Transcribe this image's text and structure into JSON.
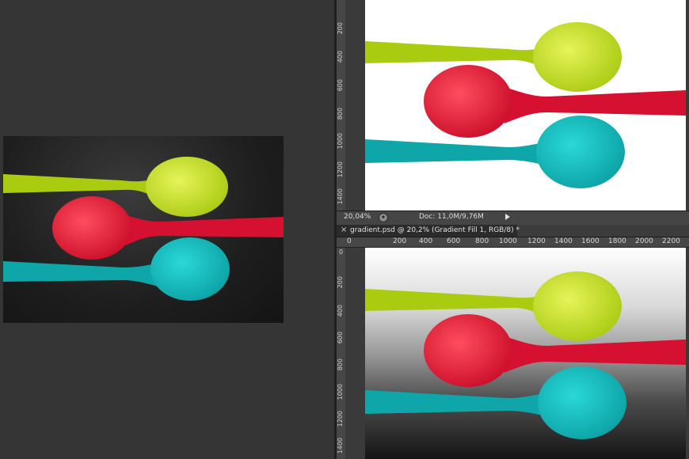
{
  "left_preview": {
    "image_description_icon": "spoons-photo-dark"
  },
  "document1": {
    "vertical_ruler_labels": [
      "200",
      "400",
      "600",
      "800",
      "1000",
      "1200",
      "1400"
    ]
  },
  "status_bar": {
    "zoom": "20,04%",
    "doc_size": "Doc: 11,0M/9,76M"
  },
  "document2": {
    "tab_close": "×",
    "tab_title": "gradient.psd @ 20,2% (Gradient Fill 1, RGB/8) *",
    "horizontal_ruler_labels": [
      "0",
      "200",
      "400",
      "600",
      "800",
      "1000",
      "1200",
      "1400",
      "1600",
      "1800",
      "2000",
      "2200"
    ],
    "vertical_ruler_labels": [
      "0",
      "200",
      "400",
      "600",
      "800",
      "1000",
      "1200",
      "1400"
    ]
  },
  "colors": {
    "spoon_lime": "#b8d81e",
    "spoon_red": "#e01434",
    "spoon_teal": "#12b7b9",
    "app_bg": "#2f2f2f"
  }
}
